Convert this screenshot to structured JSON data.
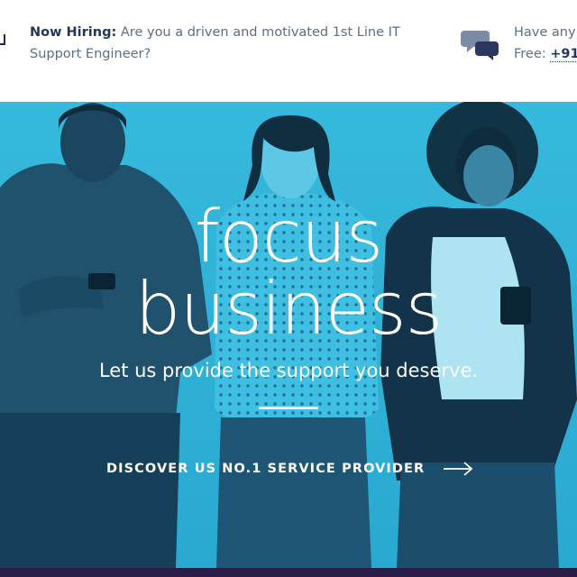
{
  "topbar": {
    "hiring_lead": "Now Hiring:",
    "hiring_text": "Are you a driven and motivated 1st Line IT Support Engineer?",
    "contact_line1": "Have any",
    "contact_line2_prefix": "Free:",
    "contact_phone": "+91",
    "icon": "chat-bubbles-icon"
  },
  "hero": {
    "title_line1": "focus",
    "title_line2": "business",
    "subtitle": "Let us provide the support you deserve.",
    "cta_label": "DISCOVER US NO.1 SERVICE PROVIDER",
    "cta_icon": "arrow-right-icon"
  },
  "colors": {
    "hero_tint": "#2fb3d7",
    "text_dark": "#24365c",
    "text_muted": "#5b6f86",
    "bottom_strip": "#2a1d48"
  }
}
